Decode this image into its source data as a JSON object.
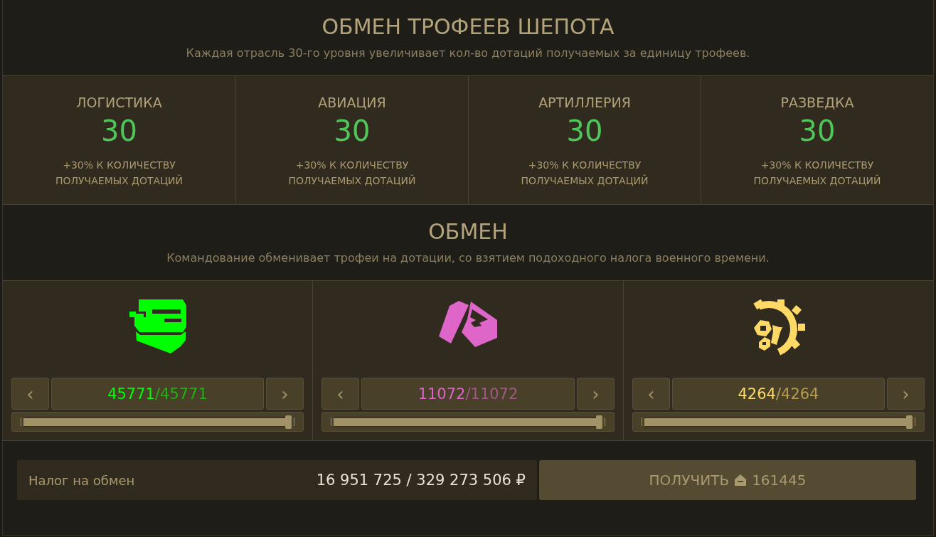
{
  "header": {
    "title": "ОБМЕН ТРОФЕЕВ ШЕПОТА",
    "subtitle": "Каждая отрасль 30-го уровня увеличивает кол-во дотаций получаемых за единицу трофеев."
  },
  "branches": [
    {
      "name": "ЛОГИСТИКА",
      "level_text": "30",
      "bonus": "+30% К КОЛИЧЕСТВУ ПОЛУЧАЕМЫХ ДОТАЦИЙ"
    },
    {
      "name": "АВИАЦИЯ",
      "level_text": "30",
      "bonus": "+30% К КОЛИЧЕСТВУ ПОЛУЧАЕМЫХ ДОТАЦИЙ"
    },
    {
      "name": "АРТИЛЛЕРИЯ",
      "level_text": "30",
      "bonus": "+30% К КОЛИЧЕСТВУ ПОЛУЧАЕМЫХ ДОТАЦИЙ"
    },
    {
      "name": "РАЗВЕДКА",
      "level_text": "30",
      "bonus": "+30% К КОЛИЧЕСТВУ ПОЛУЧАЕМЫХ ДОТАЦИЙ"
    }
  ],
  "exchange": {
    "title": "ОБМЕН",
    "subtitle": "Командование обменивает трофеи на дотации, со взятием подоходного налога военного времени."
  },
  "trophies": [
    {
      "kind": "tank",
      "color": "#00ff00",
      "amount": "45771",
      "separator": "/",
      "max": "45771",
      "level": 1,
      "prev": "‹",
      "next": "›"
    },
    {
      "kind": "boxes",
      "color": "#dd66c8",
      "amount": "11072",
      "separator": "/",
      "max": "11072",
      "level": 1,
      "prev": "‹",
      "next": "›"
    },
    {
      "kind": "gear",
      "color": "#ffd966",
      "amount": "4264",
      "separator": "/",
      "max": "4264",
      "level": 1,
      "prev": "‹",
      "next": "›"
    }
  ],
  "tax": {
    "label": "Налог на обмен",
    "value": "16 951 725 / 329 273 506 ₽"
  },
  "receive_button": {
    "label": "ПОЛУЧИТЬ",
    "amount": "161445"
  }
}
